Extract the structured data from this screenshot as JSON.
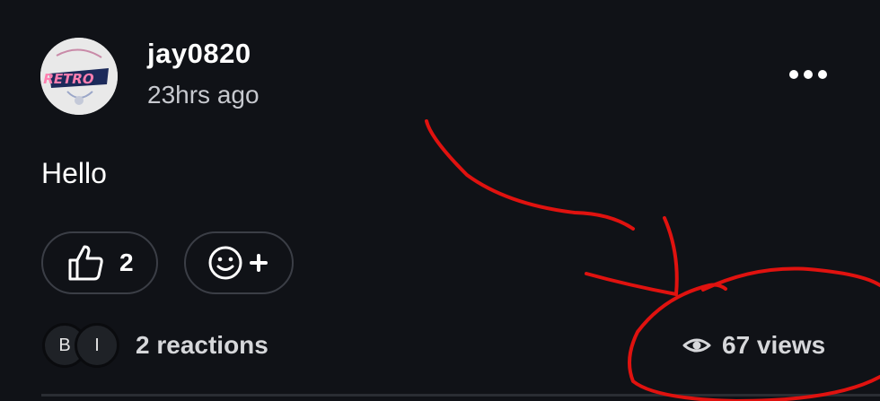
{
  "post": {
    "author": {
      "username": "jay0820",
      "avatar_icon": "user-avatar-retro-logo"
    },
    "timestamp": "23hrs ago",
    "text": "Hello",
    "more_icon": "more-horizontal-icon"
  },
  "actions": {
    "like": {
      "icon": "thumbs-up-icon",
      "count": "2"
    },
    "add_reaction": {
      "icon": "smiley-plus-icon"
    }
  },
  "footer": {
    "reactors": [
      "B",
      "I"
    ],
    "reactions_label": "2 reactions",
    "views_icon": "eye-icon",
    "views_label": "67 views"
  },
  "annotation": {
    "color": "#e0120f",
    "shape": "red hand-drawn arrow and circle around views"
  },
  "colors": {
    "background": "#101217",
    "border": "#3b3e46",
    "text_primary": "#ffffff",
    "text_secondary": "#c7c9cf"
  }
}
